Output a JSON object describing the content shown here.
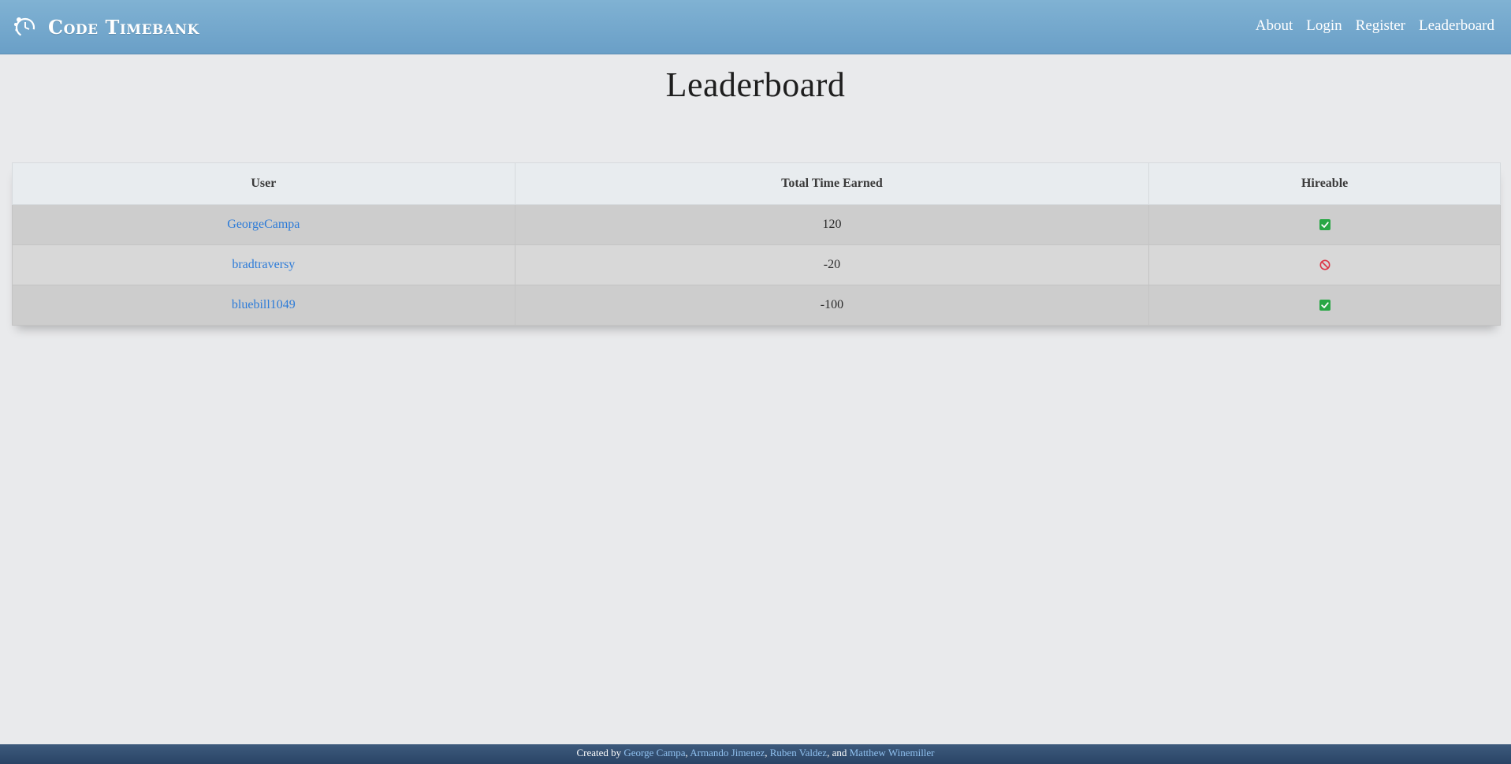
{
  "brand": {
    "name": "Code Timebank",
    "logo_icon": "clock-logo-icon"
  },
  "nav": {
    "links": [
      {
        "label": "About"
      },
      {
        "label": "Login"
      },
      {
        "label": "Register"
      },
      {
        "label": "Leaderboard"
      }
    ]
  },
  "page": {
    "title": "Leaderboard"
  },
  "table": {
    "headers": [
      "User",
      "Total Time Earned",
      "Hireable"
    ],
    "rows": [
      {
        "user": "GeorgeCampa",
        "time": "120",
        "hireable": "check-icon"
      },
      {
        "user": "bradtraversy",
        "time": "-20",
        "hireable": "ban-icon"
      },
      {
        "user": "bluebill1049",
        "time": "-100",
        "hireable": "check-icon"
      }
    ]
  },
  "footer": {
    "prefix": "Created by",
    "authors": [
      "George Campa",
      "Armando Jimenez",
      "Ruben Valdez",
      "Matthew Winemiller"
    ],
    "sep1": ",",
    "sep2": ",",
    "sep3": ", and"
  },
  "colors": {
    "navbar": "#6a9fc7",
    "link": "#2c7bd8",
    "check": "#28a745",
    "ban": "#dc3545",
    "footer": "#2a4466"
  }
}
